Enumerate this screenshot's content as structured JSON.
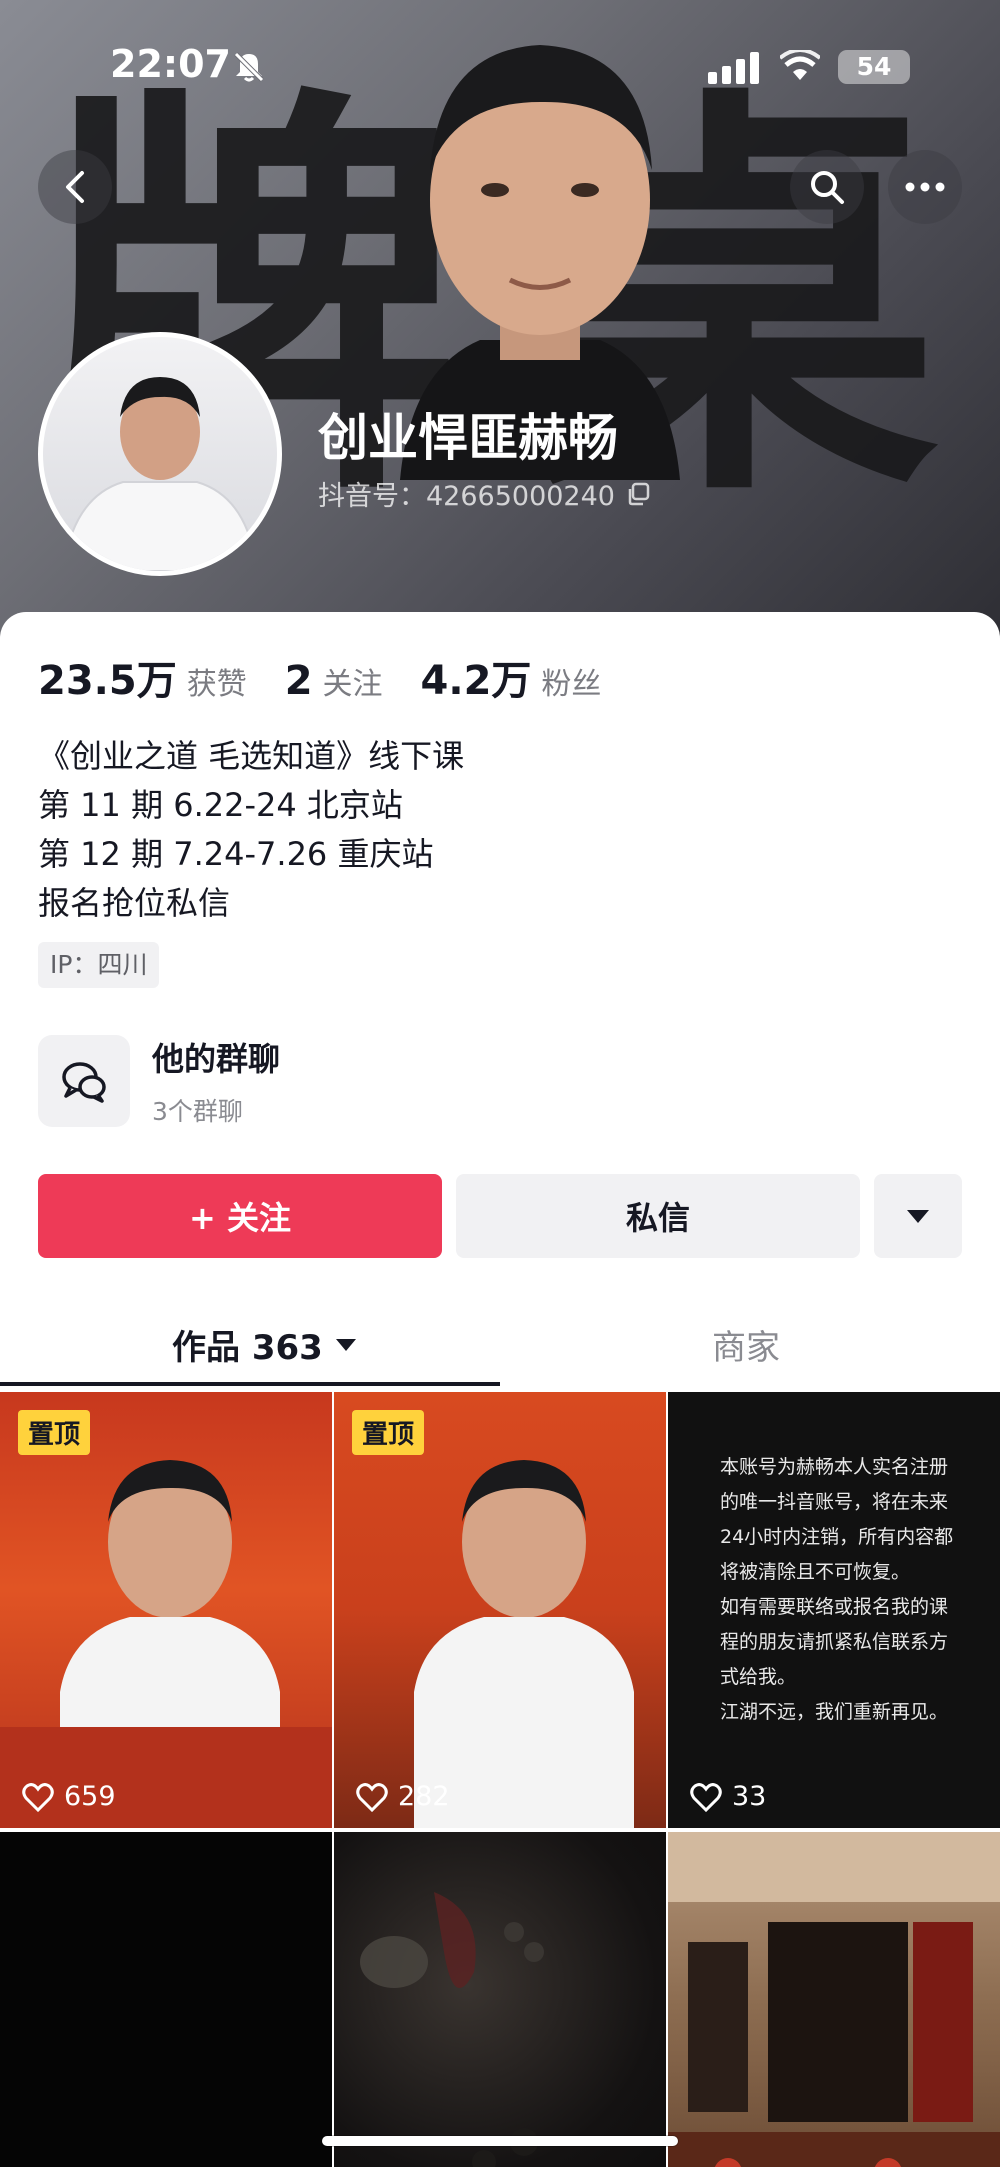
{
  "status_bar": {
    "time": "22:07",
    "battery": "54"
  },
  "profile": {
    "name": "创业悍匪赫畅",
    "douyin_id": "抖音号：42665000240",
    "stats": [
      {
        "value": "23.5万",
        "label": "获赞"
      },
      {
        "value": "2",
        "label": "关注"
      },
      {
        "value": "4.2万",
        "label": "粉丝"
      }
    ],
    "bio": [
      "《创业之道 毛选知道》线下课",
      "第 11 期 6.22-24 北京站",
      "第 12 期 7.24-7.26 重庆站",
      "报名抢位私信"
    ],
    "ip": "IP：四川"
  },
  "group_chat": {
    "title": "他的群聊",
    "subtitle": "3个群聊"
  },
  "actions": {
    "follow": "+ 关注",
    "message": "私信"
  },
  "tabs": {
    "works": "作品 363",
    "shop": "商家"
  },
  "videos": [
    {
      "pinned": "置顶",
      "likes": "659"
    },
    {
      "pinned": "置顶",
      "likes": "282"
    },
    {
      "likes": "33",
      "notice": "本账号为赫畅本人实名注册\n的唯一抖音账号，将在未来\n24小时内注销，所有内容都\n将被清除且不可恢复。\n如有需要联络或报名我的课\n程的朋友请抓紧私信联系方\n式给我。\n江湖不远，我们重新再见。"
    },
    {},
    {},
    {}
  ],
  "colors": {
    "accent": "#ee3a57",
    "pin_badge": "#ffd23c"
  }
}
